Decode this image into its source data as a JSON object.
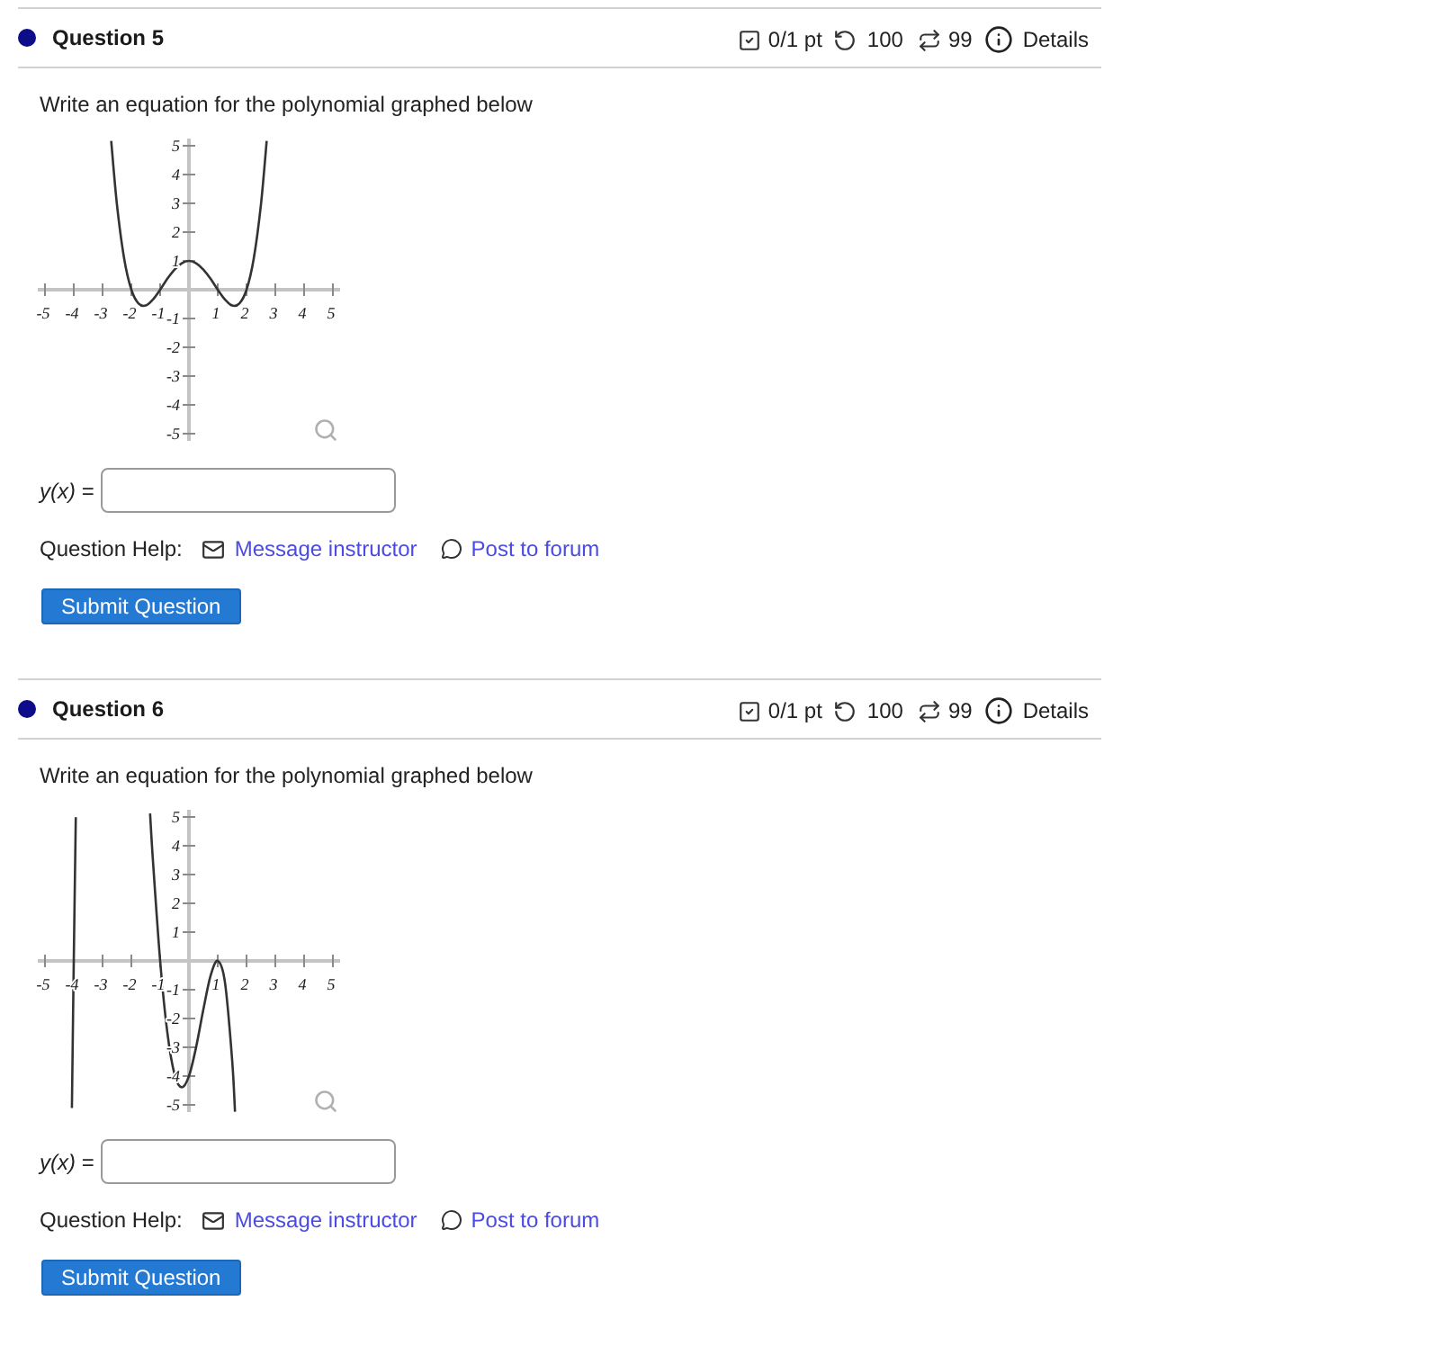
{
  "questions": [
    {
      "title": "Question 5",
      "color": "#0d0d8a",
      "score": "0/1 pt",
      "attempts": "100",
      "submissions": "99",
      "details": "Details",
      "prompt": "Write an equation for the polynomial graphed below",
      "chart_data": {
        "type": "line",
        "x": [
          -2.7,
          -2.5,
          -2.25,
          -2,
          -1.75,
          -1.5,
          -1.25,
          -1,
          -0.75,
          -0.5,
          -0.25,
          0,
          0.25,
          0.5,
          0.75,
          1,
          1.25,
          1.5,
          1.75,
          2,
          2.25,
          2.5,
          2.7
        ],
        "values": [
          5.17,
          2.95,
          1.08,
          0,
          -0.48,
          -0.55,
          -0.34,
          0,
          0.38,
          0.7,
          0.92,
          1,
          0.92,
          0.7,
          0.38,
          0,
          -0.34,
          -0.55,
          -0.48,
          0,
          1.08,
          2.95,
          5.17
        ],
        "xlim": [
          -5.25,
          5.25
        ],
        "ylim": [
          -5.25,
          5.25
        ],
        "xticks": [
          -5,
          -4,
          -3,
          -2,
          -1,
          1,
          2,
          3,
          4,
          5
        ],
        "yticks": [
          -5,
          -4,
          -3,
          -2,
          -1,
          1,
          2,
          3,
          4,
          5
        ]
      },
      "answer": {
        "label": "*y(x)* ="
      },
      "help": {
        "label": "Question Help:",
        "links": [
          {
            "kind": "message",
            "label": "Message instructor"
          },
          {
            "kind": "forum",
            "label": "Post to forum"
          }
        ]
      },
      "submit": "Submit Question"
    },
    {
      "title": "Question 6",
      "color": "#0d0d8a",
      "score": "0/1 pt",
      "attempts": "100",
      "submissions": "99",
      "details": "Details",
      "prompt": "Write an equation for the polynomial graphed below",
      "chart_data": {
        "type": "line",
        "x": [
          -4.065,
          -4,
          -3.93,
          -2.5,
          -1.35,
          -1.25,
          -1,
          -0.75,
          -0.5,
          -0.25,
          0,
          0.25,
          0.5,
          0.75,
          1,
          1.25,
          1.5,
          1.6
        ],
        "values": [
          -5.11,
          0,
          4.99,
          null,
          5.12,
          3.48,
          0,
          -2.49,
          -3.94,
          -4.39,
          -4,
          -2.99,
          -1.69,
          -0.52,
          0,
          -0.74,
          -3.44,
          -5.24
        ],
        "xlim": [
          -5.25,
          5.25
        ],
        "ylim": [
          -5.25,
          5.25
        ],
        "xticks": [
          -5,
          -4,
          -3,
          -2,
          -1,
          1,
          2,
          3,
          4,
          5
        ],
        "yticks": [
          -5,
          -4,
          -3,
          -2,
          -1,
          1,
          2,
          3,
          4,
          5
        ]
      },
      "answer": {
        "label": "*y(x)* ="
      },
      "help": {
        "label": "Question Help:",
        "links": [
          {
            "kind": "message",
            "label": "Message instructor"
          },
          {
            "kind": "forum",
            "label": "Post to forum"
          }
        ]
      },
      "submit": "Submit Question"
    }
  ]
}
